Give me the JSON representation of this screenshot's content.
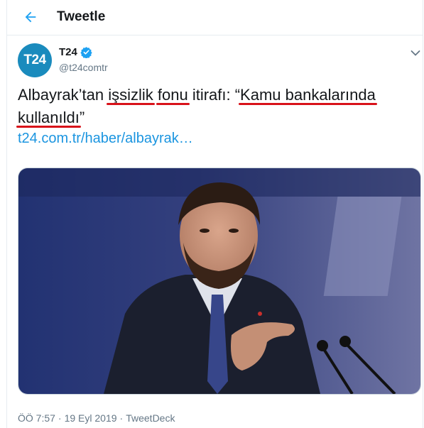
{
  "header": {
    "title": "Tweetle"
  },
  "tweet": {
    "author_name": "T24",
    "author_handle": "@t24comtr",
    "avatar_text": "T24",
    "text_parts": [
      "Albayrak’tan ",
      "işsizlik",
      " ",
      "fonu",
      " itirafı: “",
      "Kamu bankalarında",
      " ",
      "kullanıldı",
      "”"
    ],
    "link": "t24.com.tr/haber/albayrak…",
    "time": "ÖÖ 7:57",
    "separator1": "·",
    "date": "19 Eyl 2019",
    "separator2": "·",
    "source": "TweetDeck"
  },
  "colors": {
    "accent": "#1b95e0",
    "underline": "#d8121a",
    "avatar": "#1a8bbd"
  }
}
